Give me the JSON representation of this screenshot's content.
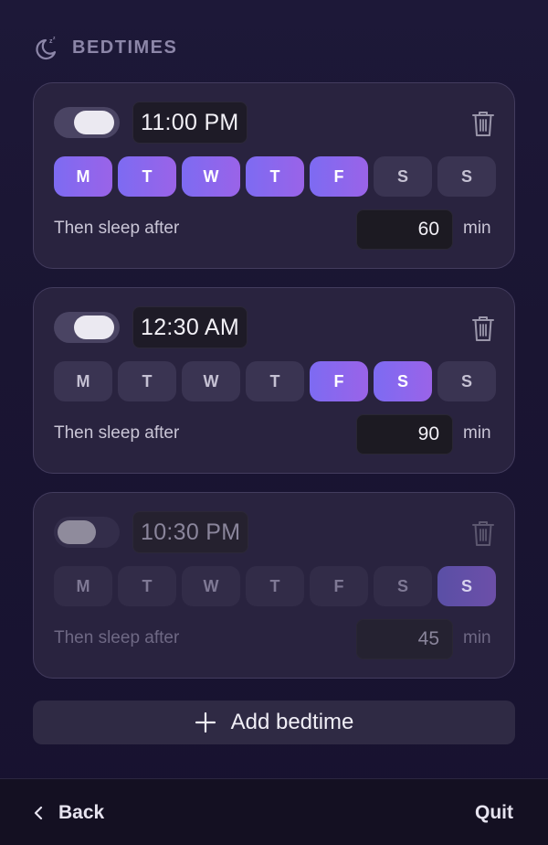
{
  "header": {
    "title": "BEDTIMES",
    "icon": "moon-zzz-icon"
  },
  "bedtimes": [
    {
      "enabled": true,
      "time": "11:00 PM",
      "days": [
        {
          "label": "M",
          "on": true
        },
        {
          "label": "T",
          "on": true
        },
        {
          "label": "W",
          "on": true
        },
        {
          "label": "T",
          "on": true
        },
        {
          "label": "F",
          "on": true
        },
        {
          "label": "S",
          "on": false
        },
        {
          "label": "S",
          "on": false
        }
      ],
      "sleep_label": "Then sleep after",
      "sleep_value": "60",
      "sleep_unit": "min"
    },
    {
      "enabled": true,
      "time": "12:30 AM",
      "days": [
        {
          "label": "M",
          "on": false
        },
        {
          "label": "T",
          "on": false
        },
        {
          "label": "W",
          "on": false
        },
        {
          "label": "T",
          "on": false
        },
        {
          "label": "F",
          "on": true
        },
        {
          "label": "S",
          "on": true
        },
        {
          "label": "S",
          "on": false
        }
      ],
      "sleep_label": "Then sleep after",
      "sleep_value": "90",
      "sleep_unit": "min"
    },
    {
      "enabled": false,
      "time": "10:30 PM",
      "days": [
        {
          "label": "M",
          "on": false
        },
        {
          "label": "T",
          "on": false
        },
        {
          "label": "W",
          "on": false
        },
        {
          "label": "T",
          "on": false
        },
        {
          "label": "F",
          "on": false
        },
        {
          "label": "S",
          "on": false
        },
        {
          "label": "S",
          "on": true
        }
      ],
      "sleep_label": "Then sleep after",
      "sleep_value": "45",
      "sleep_unit": "min"
    }
  ],
  "add_button": {
    "label": "Add bedtime",
    "icon": "plus-icon"
  },
  "footer": {
    "back_label": "Back",
    "back_icon": "chevron-left-icon",
    "quit_label": "Quit"
  },
  "colors": {
    "accent_start": "#7d6bf2",
    "accent_end": "#9a63e8",
    "background": "#1b1634",
    "card": "#29233f"
  }
}
